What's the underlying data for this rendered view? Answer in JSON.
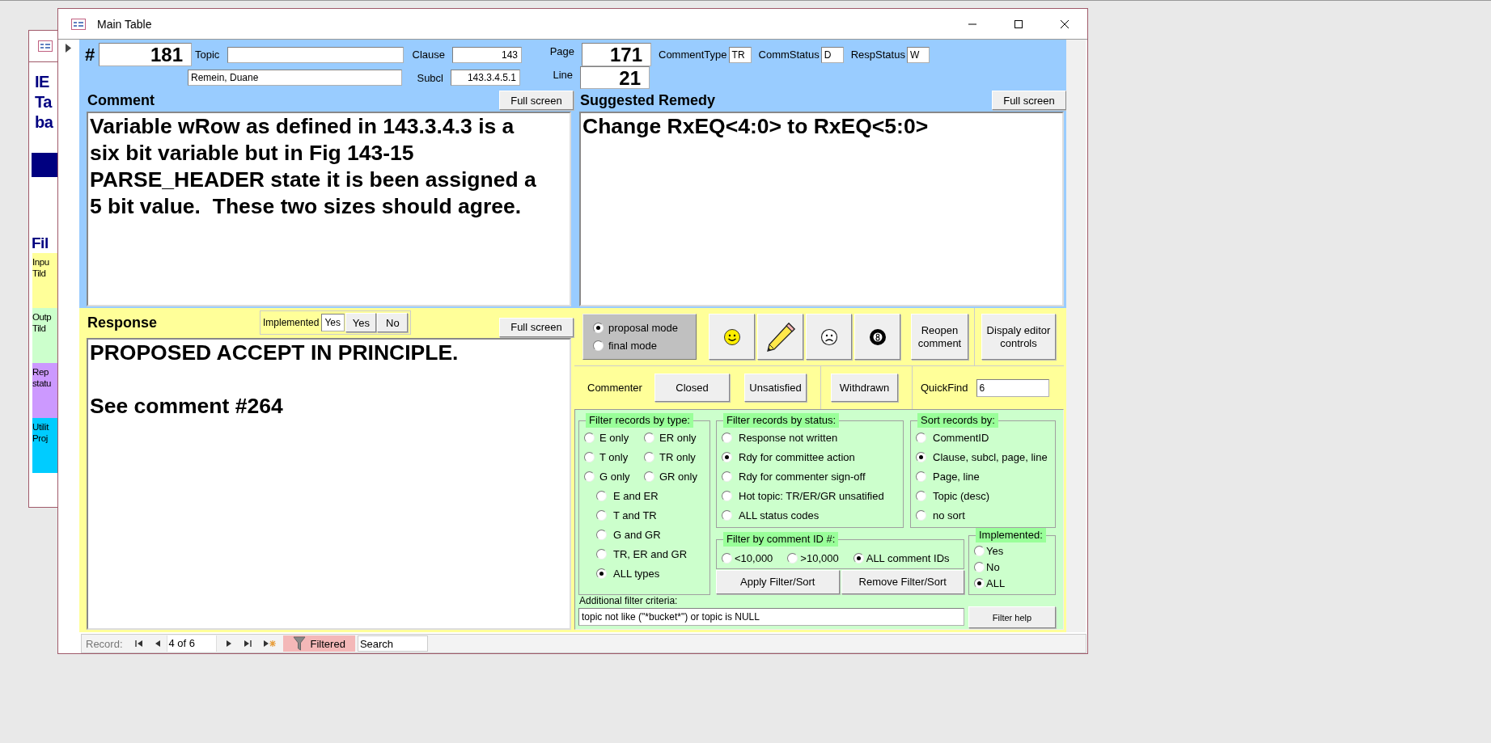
{
  "background_window": {
    "heading_lines": [
      "IE",
      "Ta",
      "ba"
    ],
    "section_heading": "Fil",
    "tiles": [
      {
        "lines": [
          "Inpu",
          "Tild"
        ],
        "color": "#ffff99"
      },
      {
        "lines": [
          "Outp",
          "Tild"
        ],
        "color": "#ccffcc"
      },
      {
        "lines": [
          "Rep",
          "statu"
        ],
        "color": "#cc99ff"
      },
      {
        "lines": [
          "Utilit",
          "Proj"
        ],
        "color": "#00ccff"
      }
    ]
  },
  "window": {
    "title": "Main Table"
  },
  "header": {
    "number": {
      "label": "#",
      "value": "181"
    },
    "topic": {
      "label": "Topic"
    },
    "commenter": {
      "value": "Remein, Duane"
    },
    "clause": {
      "label": "Clause",
      "value": "143"
    },
    "subclause": {
      "label": "Subcl",
      "value": "143.3.4.5.1"
    },
    "page": {
      "label": "Page",
      "value": "171"
    },
    "line": {
      "label": "Line",
      "value": "21"
    },
    "status_fields": [
      {
        "label": "CommentType",
        "value": "TR"
      },
      {
        "label": "CommStatus",
        "value": "D"
      },
      {
        "label": "RespStatus",
        "value": "W"
      }
    ]
  },
  "comment": {
    "title": "Comment",
    "button": "Full screen",
    "text": "Variable wRow as defined in 143.3.4.3 is a six bit variable but in Fig 143-15 PARSE_HEADER state it is been assigned a 5 bit value.  These two sizes should agree."
  },
  "remedy": {
    "title": "Suggested Remedy",
    "button": "Full screen",
    "text": "Change RxEQ<4:0> to RxEQ<5:0>"
  },
  "response": {
    "title": "Response",
    "implemented": {
      "label": "Implemented",
      "value": "Yes",
      "buttons": [
        "Yes",
        "No"
      ]
    },
    "button": "Full screen",
    "text": "PROPOSED ACCEPT IN PRINCIPLE.\n\nSee comment #264"
  },
  "modes": [
    {
      "label": "proposal mode",
      "selected": true
    },
    {
      "label": "final mode",
      "selected": false
    }
  ],
  "icon_buttons": [
    {
      "kind": "smiley"
    },
    {
      "kind": "pencil"
    },
    {
      "kind": "frown"
    },
    {
      "kind": "eight-ball"
    }
  ],
  "reopen_button": "Reopen comment",
  "editor_button": "Dispaly editor controls",
  "commenter": {
    "label": "Commenter",
    "buttons": [
      "Closed",
      "Unsatisfied"
    ],
    "withdrawn_button": "Withdrawn",
    "quickfind": {
      "label": "QuickFind",
      "value": "6"
    }
  },
  "filter_type": {
    "title": "Filter records by type:",
    "pairs": [
      [
        {
          "label": "E only",
          "selected": false
        },
        {
          "label": "ER only",
          "selected": false
        }
      ],
      [
        {
          "label": "T only",
          "selected": false
        },
        {
          "label": "TR only",
          "selected": false
        }
      ],
      [
        {
          "label": "G only",
          "selected": false
        },
        {
          "label": "GR only",
          "selected": false
        }
      ]
    ],
    "combined": [
      {
        "label": "E and ER",
        "selected": false
      },
      {
        "label": "T and TR",
        "selected": false
      },
      {
        "label": "G and GR",
        "selected": false
      },
      {
        "label": "TR, ER and GR",
        "selected": false
      },
      {
        "label": "ALL types",
        "selected": true
      }
    ]
  },
  "filter_status": {
    "title": "Filter records by status:",
    "options": [
      {
        "label": "Response not written",
        "selected": false
      },
      {
        "label": "Rdy for committee action",
        "selected": true
      },
      {
        "label": "Rdy for commenter sign-off",
        "selected": false
      },
      {
        "label": "Hot topic: TR/ER/GR unsatified",
        "selected": false
      },
      {
        "label": "ALL status codes",
        "selected": false
      }
    ]
  },
  "sort": {
    "title": "Sort records by:",
    "options": [
      {
        "label": "CommentID",
        "selected": false
      },
      {
        "label": "Clause, subcl, page, line",
        "selected": true
      },
      {
        "label": "Page, line",
        "selected": false
      },
      {
        "label": "Topic (desc)",
        "selected": false
      },
      {
        "label": "no sort",
        "selected": false
      }
    ]
  },
  "filter_id": {
    "title": "Filter by comment ID #:",
    "options": [
      {
        "label": "<10,000",
        "selected": false
      },
      {
        "label": ">10,000",
        "selected": false
      },
      {
        "label": "ALL comment IDs",
        "selected": true
      }
    ]
  },
  "implemented_filter": {
    "title": "Implemented:",
    "options": [
      {
        "label": "Yes",
        "selected": false
      },
      {
        "label": "No",
        "selected": false
      },
      {
        "label": "ALL",
        "selected": true
      }
    ]
  },
  "filter_buttons": [
    "Apply Filter/Sort",
    "Remove Filter/Sort"
  ],
  "additional": {
    "label": "Additional filter criteria:",
    "value": "topic not like (\"*bucket*\") or topic is NULL",
    "help_button": "Filter help"
  },
  "record_bar": {
    "label": "Record:",
    "position": "4 of 6",
    "filter": "Filtered",
    "search": "Search"
  }
}
